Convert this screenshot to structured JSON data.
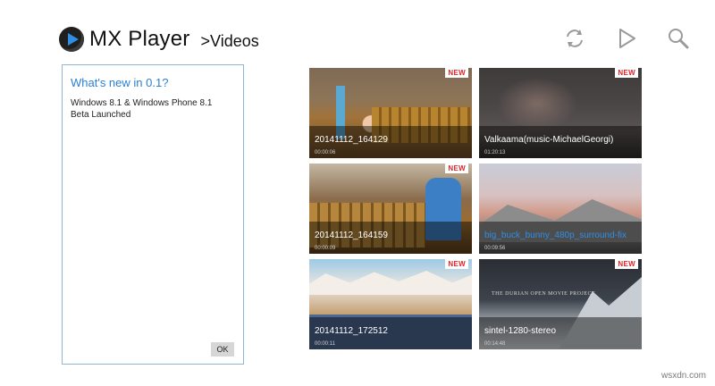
{
  "header": {
    "app_title": "MX Player",
    "breadcrumb": ">Videos",
    "logo_icon": "mx-player-logo-icon"
  },
  "toolbar": {
    "refresh_icon": "refresh-icon",
    "play_icon": "play-icon",
    "search_icon": "search-icon"
  },
  "notice": {
    "title": "What's new in 0.1?",
    "body_line1": "Windows 8.1 & Windows Phone 8.1",
    "body_line2": "Beta Launched",
    "ok_label": "OK"
  },
  "videos": [
    {
      "title": "20141112_164129",
      "duration": "00:00:06",
      "badge": "NEW",
      "title_color": "#ffffff"
    },
    {
      "title": "Valkaama(music-MichaelGeorgi)",
      "duration": "01:20:13",
      "badge": "NEW",
      "title_color": "#ffffff"
    },
    {
      "title": "20141112_164159",
      "duration": "00:00:09",
      "badge": "NEW",
      "title_color": "#ffffff"
    },
    {
      "title": "big_buck_bunny_480p_surround-fix",
      "duration": "00:09:56",
      "badge": "",
      "title_color": "#2f8ee5"
    },
    {
      "title": "20141112_172512",
      "duration": "00:00:11",
      "badge": "NEW",
      "title_color": "#ffffff"
    },
    {
      "title": "sintel-1280-stereo",
      "duration": "00:14:48",
      "badge": "NEW",
      "title_color": "#ffffff"
    }
  ],
  "thumb_text": {
    "sintel_banner": "THE DURIAN OPEN MOVIE PROJECT"
  },
  "watermark": "wsxdn.com",
  "colors": {
    "accent": "#2f8ee5",
    "new_badge": "#d9262b"
  }
}
